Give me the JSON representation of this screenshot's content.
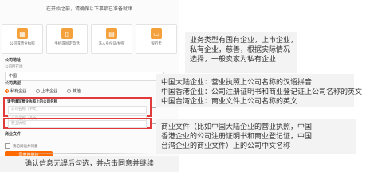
{
  "intro_text": "在开始之前，请确保以下事项已准备就绪",
  "cards": [
    {
      "icon": "building-icon",
      "label": "公司或营业执照"
    },
    {
      "icon": "phone-icon",
      "label": "手机或固定电话"
    },
    {
      "icon": "id-card-icon",
      "label": "法人身份证/护照"
    },
    {
      "icon": "bank-card-icon",
      "label": "银行卡"
    }
  ],
  "form": {
    "country_label": "公司地址",
    "country_hint": "公司所在地",
    "country_value": "中国",
    "type_label": "公司类型",
    "type_options": [
      "私有企业",
      "上市企业",
      "其他"
    ],
    "type_selected": 0,
    "name_section_label": "请手填写营业执照上的公司名称",
    "name_placeholder_1": "公司名称（中文）",
    "name_placeholder_2": "公司名称（英文）",
    "business_label": "商业文件",
    "business_value": "营业执照",
    "agree_text": "我已阅读并同意",
    "agree_button": "同意并继续"
  },
  "annotations": {
    "a1": [
      "业务类型有国有企业，上市企业，",
      "私有企业，慈善，根据实际情况",
      "选择，一般卖家为私有企业"
    ],
    "a2": [
      "中国大陆企业：营业执照上公司名称的汉语拼音",
      "中国香港企业：公司注册证明书和商业登记证上公司名称的英文",
      "中国台湾企业：商业文件上公司名称的英文"
    ],
    "a3": [
      "商业文件（比如中国大陆企业的营业执照，中国",
      "香港企业的公司注册证明书和商业登记证，中国",
      "台湾企业的商业文件）上的公司中文名称"
    ],
    "bottom": "确认信息无误后勾选，并点击同意并继续"
  },
  "colors": {
    "accent": "#ff6a00",
    "highlight": "#e13a3a",
    "card_icon": "#f4a03b"
  }
}
